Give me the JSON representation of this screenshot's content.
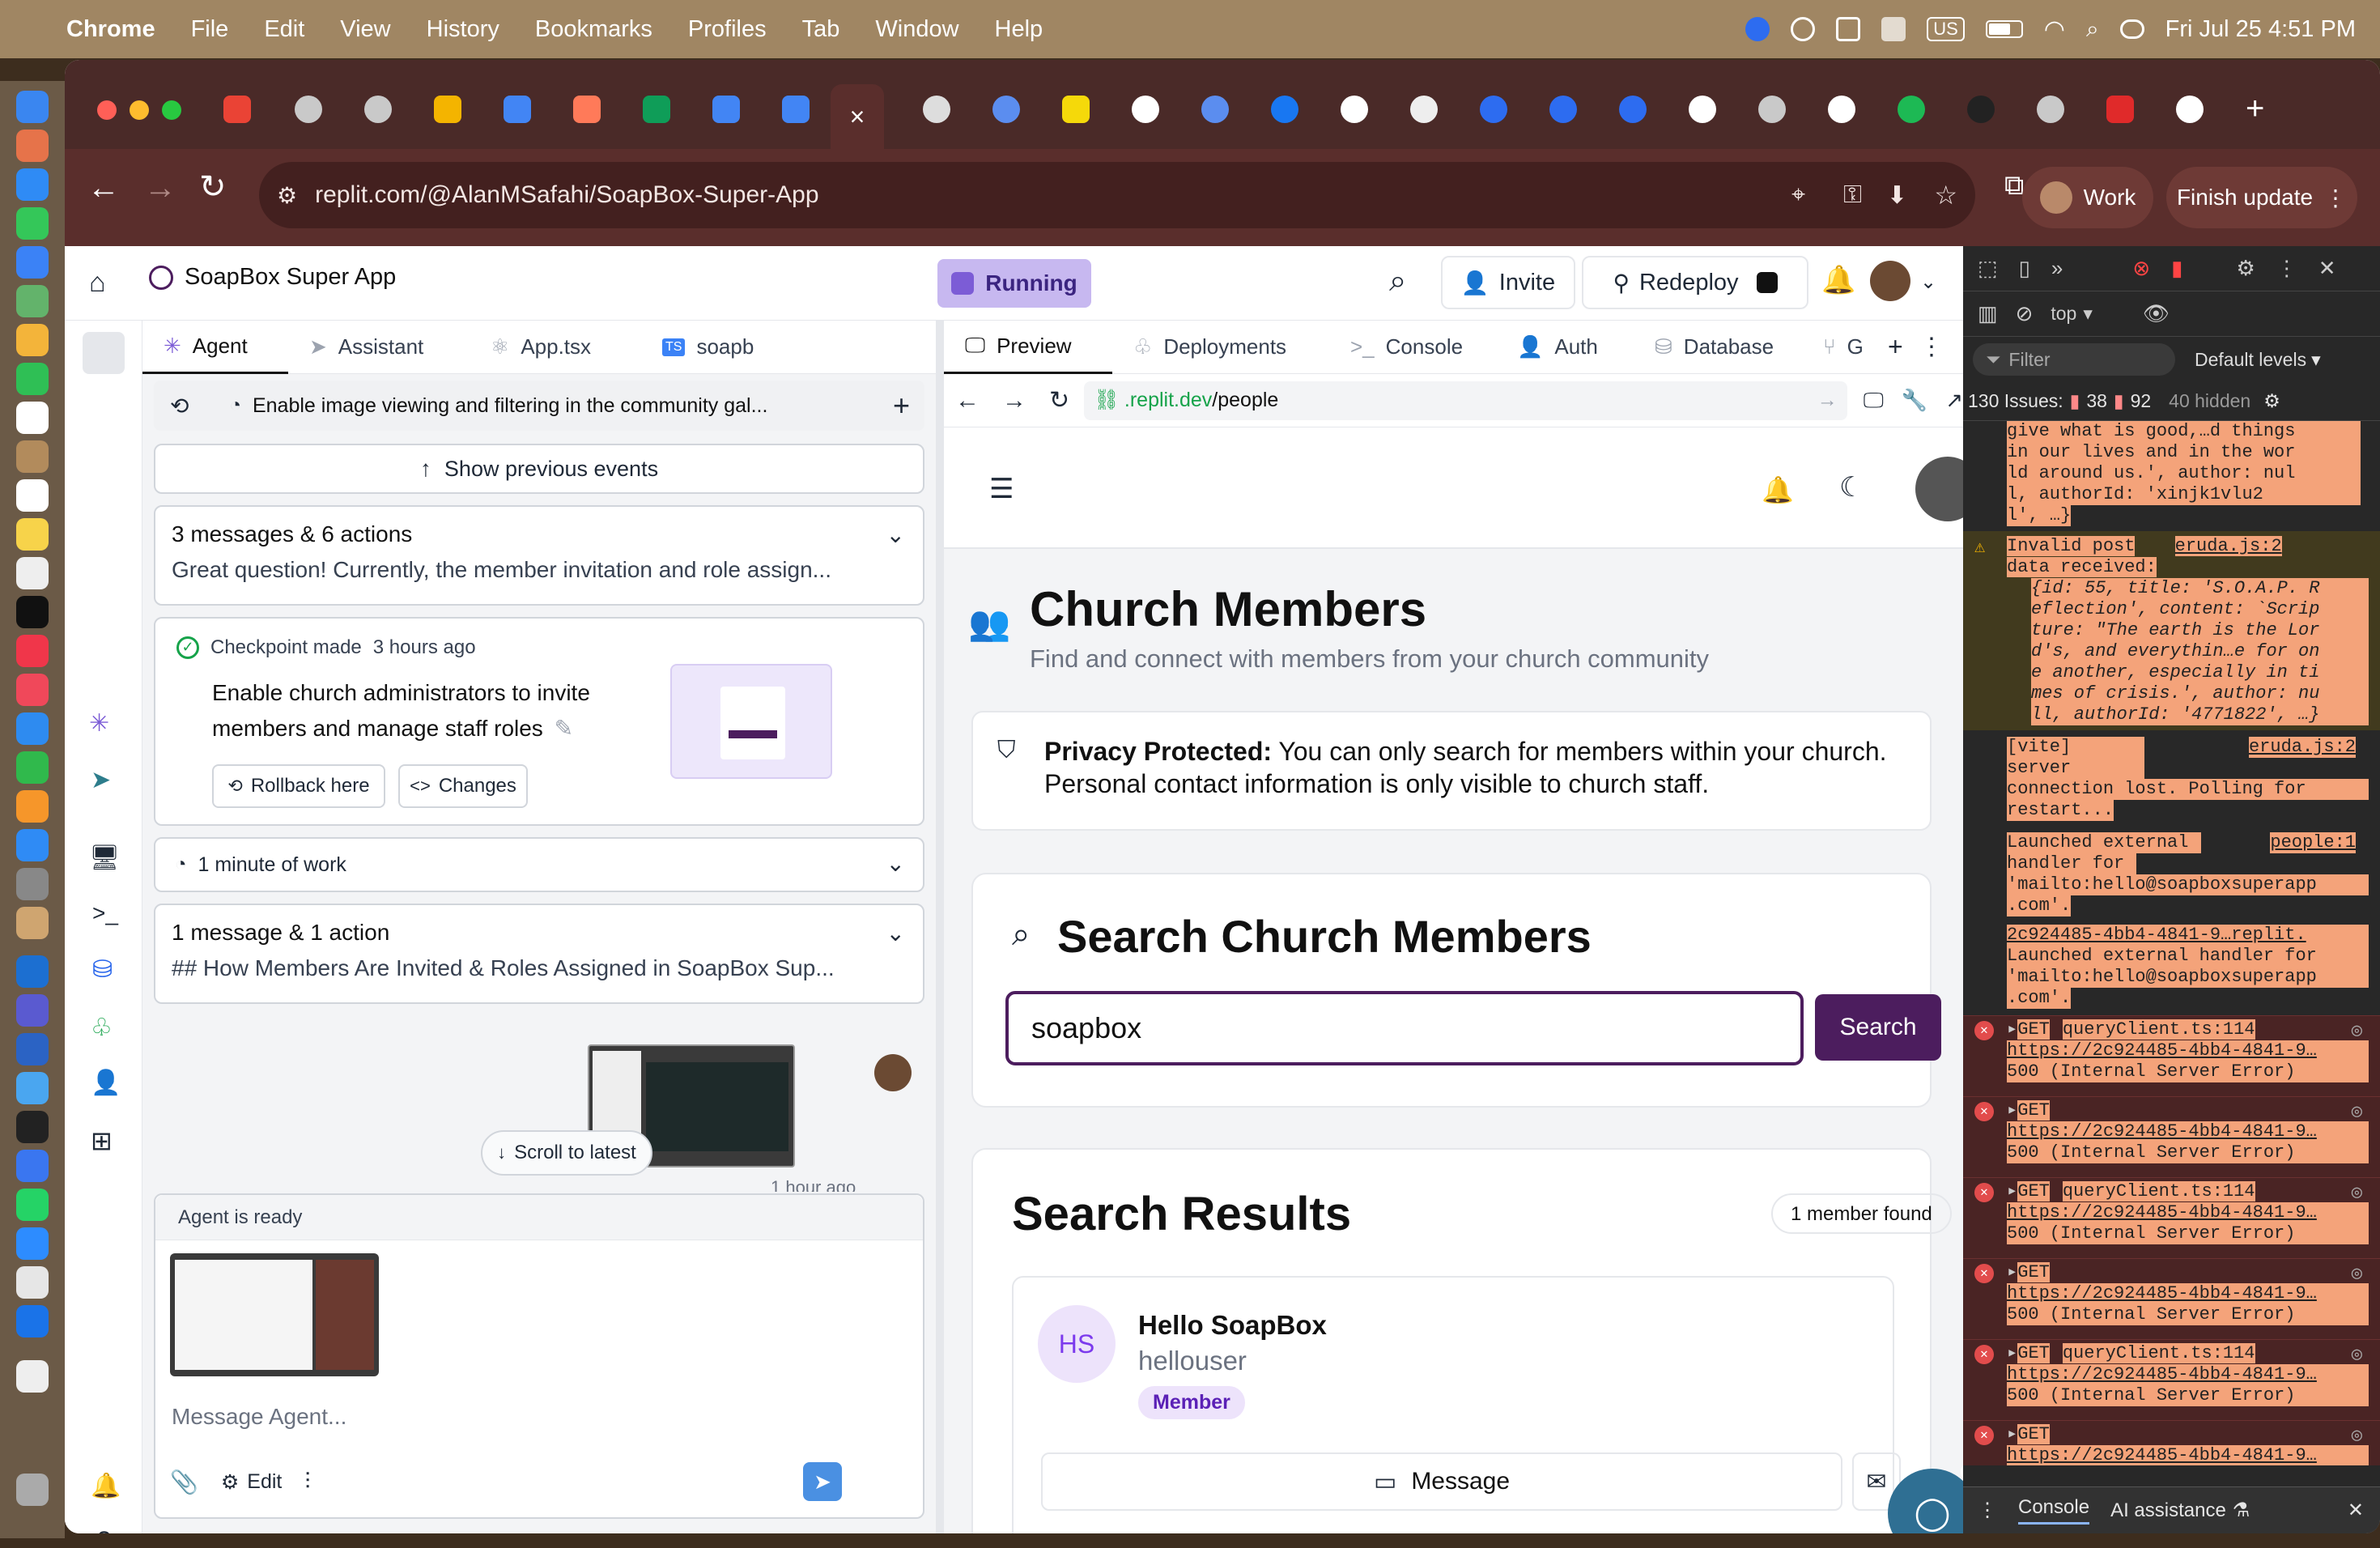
{
  "menubar": {
    "app": "Chrome",
    "menus": [
      "File",
      "Edit",
      "View",
      "History",
      "Bookmarks",
      "Profiles",
      "Tab",
      "Window",
      "Help"
    ],
    "input_badge": "US",
    "clock": "Fri Jul 25  4:51 PM"
  },
  "browser": {
    "url": "replit.com/@AlanMSafahi/SoapBox-Super-App",
    "profile_label": "Work",
    "finish_update_label": "Finish update"
  },
  "replit": {
    "project_name": "SoapBox Super App",
    "run_status": "Running",
    "invite_label": "Invite",
    "redeploy_label": "Redeploy",
    "left_tabs": [
      "Agent",
      "Assistant",
      "App.tsx",
      "soapb"
    ],
    "right_tabs": [
      "Preview",
      "Deployments",
      "Console",
      "Auth",
      "Database",
      "G"
    ],
    "agent": {
      "thread_title": "Enable image viewing and filtering in the community gal...",
      "show_previous_label": "Show previous events",
      "summary1_title": "3 messages & 6 actions",
      "summary1_text": "Great question! Currently, the member invitation and role assign...",
      "checkpoint_label": "Checkpoint made",
      "checkpoint_time": "3 hours ago",
      "checkpoint_text": "Enable church administrators to invite members and manage staff roles",
      "rollback_label": "Rollback here",
      "changes_label": "Changes",
      "work_label": "1 minute of work",
      "summary2_title": "1 message & 1 action",
      "summary2_text": "## How Members Are Invited & Roles Assigned in SoapBox Sup...",
      "scroll_latest_label": "Scroll to latest",
      "msg_time": "1 hour ago",
      "ready_label": "Agent is ready",
      "input_placeholder": "Message Agent...",
      "edit_label": "Edit"
    },
    "preview": {
      "url_host": ".replit.dev",
      "url_path": "/people",
      "page_title": "Church Members",
      "page_subtitle": "Find and connect with members from your church community",
      "privacy_strong": "Privacy Protected:",
      "privacy_text": " You can only search for members within your church. Personal contact information is only visible to church staff.",
      "search_title": "Search Church Members",
      "search_value": "soapbox",
      "search_button": "Search",
      "results_title": "Search Results",
      "results_count": "1 member found",
      "member": {
        "initials": "HS",
        "name": "Hello SoapBox",
        "username": "hellouser",
        "role": "Member",
        "message_label": "Message"
      }
    }
  },
  "devtools": {
    "context": "top",
    "filter_placeholder": "Filter",
    "levels": "Default levels",
    "issues_label": "130 Issues:",
    "issues_err": "38",
    "issues_msg": "92",
    "hidden": "40 hidden",
    "log_top": [
      "give what is good,…d things",
      "in our lives and in the wor",
      "ld around us.', author: nul",
      "l, authorId: 'xinjk1vlu2",
      "l', …}"
    ],
    "warn_title": "Invalid post",
    "warn_title2": "data received:",
    "warn_source": "eruda.js:2",
    "warn_body": [
      "{id: 55, title: 'S.O.A.P. R",
      "eflection', content: `Scrip",
      "ture: \"The earth is the Lor",
      "d's, and everythin…e for on",
      "e another, especially in ti",
      "mes of crisis.', author: nu",
      "ll, authorId: '4771822', …}"
    ],
    "vite_text": [
      "[vite] server",
      "connection lost. Polling for",
      "restart..."
    ],
    "vite_source": "eruda.js:2",
    "launch1": [
      "Launched external",
      "handler for",
      "'mailto:hello@soapboxsuperapp",
      ".com'."
    ],
    "launch1_source": "people:1",
    "launch2_link": "2c924485-4bb4-4841-9…replit.",
    "launch2": [
      "Launched external handler for",
      "'mailto:hello@soapboxsuperapp",
      ".com'."
    ],
    "errors": [
      {
        "method": "GET",
        "source": "queryClient.ts:114",
        "url": "https://2c924485-4bb4-4841-9…",
        "status": "500 (Internal Server Error)"
      },
      {
        "method": "GET",
        "source": "",
        "url": "https://2c924485-4bb4-4841-9…",
        "status": "500 (Internal Server Error)"
      },
      {
        "method": "GET",
        "source": "queryClient.ts:114",
        "url": "https://2c924485-4bb4-4841-9…",
        "status": "500 (Internal Server Error)"
      },
      {
        "method": "GET",
        "source": "",
        "url": "https://2c924485-4bb4-4841-9…",
        "status": "500 (Internal Server Error)"
      },
      {
        "method": "GET",
        "source": "queryClient.ts:114",
        "url": "https://2c924485-4bb4-4841-9…",
        "status": "500 (Internal Server Error)"
      },
      {
        "method": "GET",
        "source": "",
        "url": "https://2c924485-4bb4-4841-9…",
        "status": "500 (Internal Server Error)"
      }
    ],
    "drawer_console": "Console",
    "drawer_ai": "AI assistance"
  },
  "colors": {
    "accent_purple": "#4c1d5e",
    "running_bg": "#c7b8f0",
    "member_badge": "#ede3fb",
    "error_bg": "#4a2424",
    "highlight": "#f4a37a"
  }
}
